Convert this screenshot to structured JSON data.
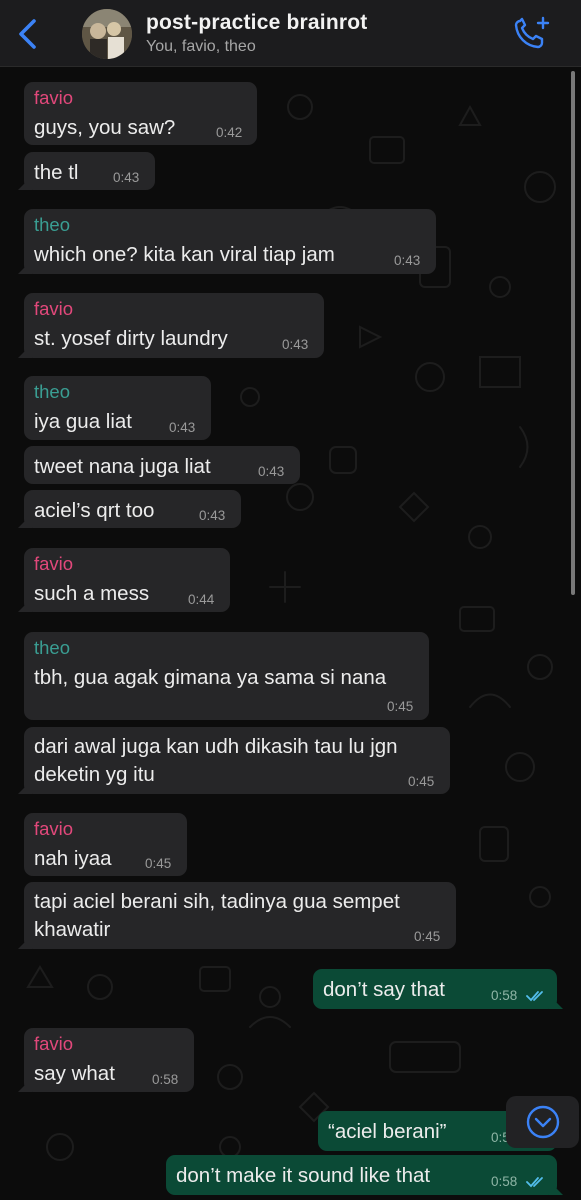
{
  "header": {
    "title": "post-practice brainrot",
    "subtitle": "You, favio, theo"
  },
  "messages": [
    {
      "sender": "favio",
      "text": "guys, you saw?",
      "time": "0:42"
    },
    {
      "text": "the tl",
      "time": "0:43"
    },
    {
      "sender": "theo",
      "text": "which one? kita kan viral tiap jam",
      "time": "0:43"
    },
    {
      "sender": "favio",
      "text": "st. yosef dirty laundry",
      "time": "0:43"
    },
    {
      "sender": "theo",
      "text": "iya gua liat",
      "time": "0:43"
    },
    {
      "text": "tweet nana juga liat",
      "time": "0:43"
    },
    {
      "text": "aciel’s qrt too",
      "time": "0:43"
    },
    {
      "sender": "favio",
      "text": "such a mess",
      "time": "0:44"
    },
    {
      "sender": "theo",
      "text": "tbh, gua agak gimana ya sama si nana",
      "time": "0:45"
    },
    {
      "text_lines": [
        "dari awal juga kan udh dikasih tau lu jgn",
        "deketin yg itu"
      ],
      "time": "0:45"
    },
    {
      "sender": "favio",
      "text": "nah iyaa",
      "time": "0:45"
    },
    {
      "text_lines": [
        "tapi aciel berani sih, tadinya gua sempet",
        "khawatir"
      ],
      "time": "0:45"
    },
    {
      "outgoing": true,
      "text": "don’t say that",
      "time": "0:58",
      "status": "read"
    },
    {
      "sender": "favio",
      "text": "say what",
      "time": "0:58"
    },
    {
      "outgoing": true,
      "text": "“aciel berani”",
      "time": "0:58",
      "status": "read"
    },
    {
      "outgoing": true,
      "text": "don’t make it sound like that",
      "time": "0:58",
      "status": "read"
    }
  ],
  "icons": {
    "back": "chevron-left-icon",
    "call": "phone-add-icon",
    "scroll_down": "chevron-down-circle-icon",
    "read": "double-check-icon"
  },
  "colors": {
    "accent_blue": "#3b82f6",
    "favio": "#e2487b",
    "theo": "#3a9e93",
    "incoming_bubble": "#262628",
    "outgoing_bubble": "#0b4a36",
    "read_ticks": "#53bdeb"
  }
}
